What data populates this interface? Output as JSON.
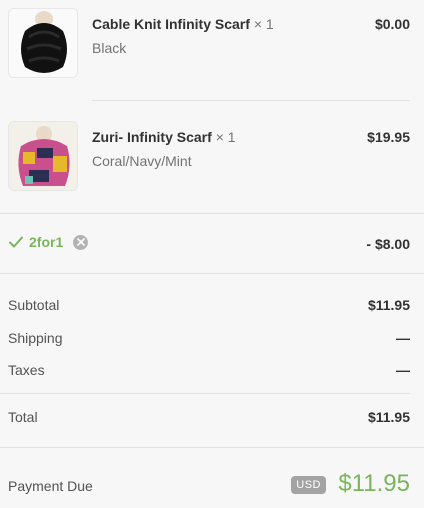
{
  "items": [
    {
      "name": "Cable Knit Infinity Scarf",
      "qty": "× 1",
      "variant": "Black",
      "price": "$0.00"
    },
    {
      "name": "Zuri- Infinity Scarf",
      "qty": "× 1",
      "variant": "Coral/Navy/Mint",
      "price": "$19.95"
    }
  ],
  "discount": {
    "code": "2for1",
    "amount": "- $8.00"
  },
  "totals": {
    "subtotal_label": "Subtotal",
    "subtotal_value": "$11.95",
    "shipping_label": "Shipping",
    "shipping_value": "—",
    "taxes_label": "Taxes",
    "taxes_value": "—",
    "total_label": "Total",
    "total_value": "$11.95"
  },
  "payment": {
    "label": "Payment Due",
    "currency": "USD",
    "amount": "$11.95"
  },
  "colors": {
    "accent_green": "#7ab55c",
    "badge_gray": "#a3a3a3"
  }
}
